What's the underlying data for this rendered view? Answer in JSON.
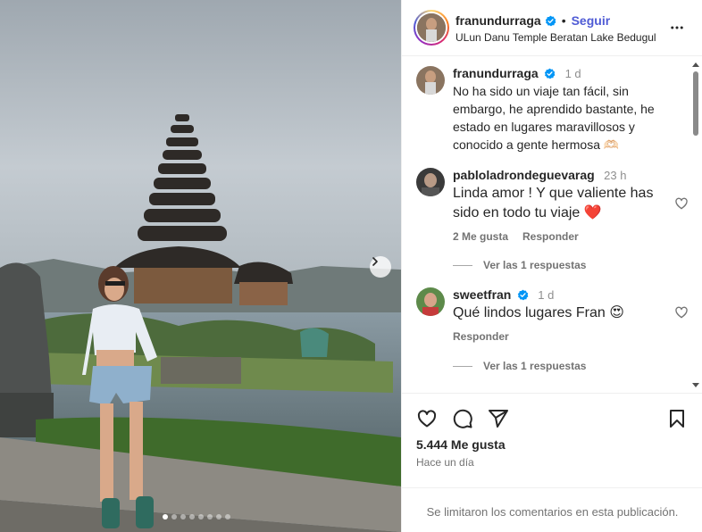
{
  "post": {
    "page_dots": 8,
    "active_dot": 0
  },
  "header": {
    "username": "franundurraga",
    "separator": "•",
    "follow_label": "Seguir",
    "location": "ULun Danu Temple Beratan Lake Bedugul"
  },
  "caption": {
    "username": "franundurraga",
    "time": "1 d",
    "text": "No ha sido un viaje tan fácil, sin embargo, he aprendido bastante, he estado en lugares maravillosos y conocido a gente hermosa 🫶🏻"
  },
  "comments": [
    {
      "username": "pabloladrondeguevarag",
      "time": "23 h",
      "text": "Linda amor ! Y que valiente has sido en todo tu viaje ❤️",
      "likes": "2 Me gusta",
      "reply": "Responder",
      "view_replies": "Ver las 1 respuestas"
    },
    {
      "username": "sweetfran",
      "time": "1 d",
      "text": "Qué lindos lugares Fran 😍",
      "likes": "",
      "reply": "Responder",
      "view_replies": "Ver las 1 respuestas"
    }
  ],
  "footer": {
    "likes": "5.444 Me gusta",
    "ago": "Hace un día",
    "comments_limited": "Se limitaron los comentarios en esta publicación."
  },
  "colors": {
    "follow": "#4f5bd5",
    "verified": "#0095f6",
    "heart_red": "#ed4956"
  },
  "icons": [
    "chevron-right-icon",
    "verified-icon",
    "more-icon",
    "heart-icon",
    "comment-icon",
    "share-icon",
    "bookmark-icon"
  ]
}
